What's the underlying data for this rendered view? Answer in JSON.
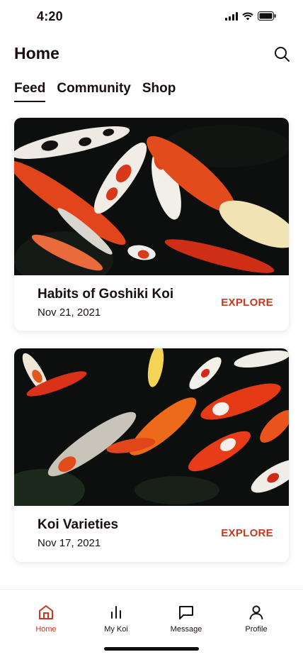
{
  "status": {
    "time": "4:20"
  },
  "header": {
    "title": "Home",
    "search_icon": "search-icon"
  },
  "tabs": [
    {
      "label": "Feed",
      "active": true
    },
    {
      "label": "Community",
      "active": false
    },
    {
      "label": "Shop",
      "active": false
    }
  ],
  "cards": [
    {
      "title": "Habits of Goshiki Koi",
      "date": "Nov 21, 2021",
      "cta": "EXPLORE"
    },
    {
      "title": "Koi Varieties",
      "date": "Nov 17, 2021",
      "cta": "EXPLORE"
    }
  ],
  "nav": [
    {
      "label": "Home",
      "icon": "home-icon",
      "active": true
    },
    {
      "label": "My Koi",
      "icon": "bar-chart-icon",
      "active": false
    },
    {
      "label": "Message",
      "icon": "message-icon",
      "active": false
    },
    {
      "label": "Profile",
      "icon": "profile-icon",
      "active": false
    }
  ],
  "colors": {
    "accent": "#c8381c",
    "text": "#1a0f0f",
    "background": "#ffffff"
  }
}
